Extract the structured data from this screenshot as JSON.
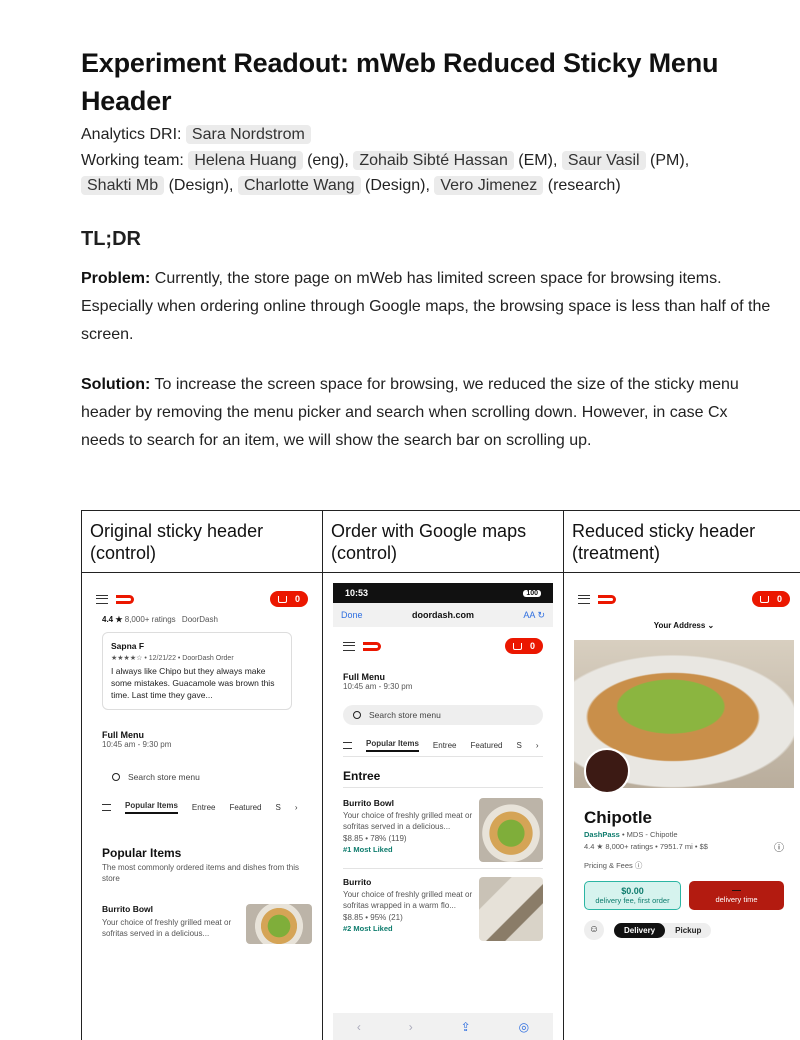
{
  "doc": {
    "title": "Experiment Readout: mWeb Reduced Sticky Menu Header",
    "analytics_label": "Analytics DRI:",
    "analytics_dri": "Sara Nordstrom",
    "team_label": "Working team:",
    "team": [
      {
        "name": "Helena Huang",
        "role": "(eng),"
      },
      {
        "name": "Zohaib Sibté Hassan",
        "role": "(EM),"
      },
      {
        "name": "Saur Vasil",
        "role": "(PM),"
      },
      {
        "name": "Shakti Mb",
        "role": "(Design),"
      },
      {
        "name": "Charlotte Wang",
        "role": "(Design),"
      },
      {
        "name": "Vero Jimenez",
        "role": "(research)"
      }
    ],
    "tldr_heading": "TL;DR",
    "problem_label": "Problem:",
    "problem_text": "Currently, the store page on mWeb has limited screen space for browsing items. Especially when ordering online through Google maps, the browsing space is less than half of the screen.",
    "solution_label": "Solution:",
    "solution_text": "To increase the screen space for browsing, we reduced the size of the sticky menu header by removing the menu picker and search when scrolling down. However, in case Cx needs to search for an item, we will show the search bar on scrolling up."
  },
  "table": {
    "headers": [
      "Original sticky header (control)",
      "Order with Google maps (control)",
      "Reduced sticky header (treatment)"
    ]
  },
  "phone1": {
    "cart_count": "0",
    "rating": "4.4 ★",
    "ratings_count": "8,000+ ratings",
    "doordash": "DoorDash",
    "reviewer": "Sapna F",
    "review_meta": "★★★★☆ • 12/21/22 • DoorDash Order",
    "review_text": "I always like Chipo but they always make some mistakes. Guacamole was brown this time. Last time they gave...",
    "full_menu": "Full Menu",
    "hours": "10:45 am - 9:30 pm",
    "search_placeholder": "Search store menu",
    "tabs": [
      "Popular Items",
      "Entree",
      "Featured",
      "S"
    ],
    "popular_title": "Popular Items",
    "popular_sub": "The most commonly ordered items and dishes from this store",
    "item_name": "Burrito Bowl",
    "item_desc": "Your choice of freshly grilled meat or sofritas served in a delicious..."
  },
  "phone2": {
    "time": "10:53",
    "battery": "100",
    "done": "Done",
    "url": "doordash.com",
    "aa": "AA",
    "cart_count": "0",
    "full_menu": "Full Menu",
    "hours": "10:45 am - 9:30 pm",
    "search_placeholder": "Search store menu",
    "tabs": [
      "Popular Items",
      "Entree",
      "Featured",
      "S"
    ],
    "section": "Entree",
    "items": [
      {
        "name": "Burrito Bowl",
        "desc": "Your choice of freshly grilled meat or sofritas served in a delicious...",
        "price": "$8.85 • 78% (119)",
        "tag": "#1 Most Liked"
      },
      {
        "name": "Burrito",
        "desc": "Your choice of freshly grilled meat or sofritas wrapped in a warm flo...",
        "price": "$8.85 • 95% (21)",
        "tag": "#2 Most Liked"
      }
    ]
  },
  "phone3": {
    "cart_count": "0",
    "address": "Your Address ⌄",
    "store": "Chipotle",
    "dashpass": "DashPass",
    "store_meta": "• MDS - Chipotle",
    "rating_line": "4.4 ★ 8,000+ ratings • 7951.7 mi • $$",
    "pricing": "Pricing & Fees ⓘ",
    "fee_amount": "$0.00",
    "fee_label": "delivery fee, first order",
    "time_amount": "—",
    "time_label": "delivery time",
    "delivery": "Delivery",
    "pickup": "Pickup"
  }
}
